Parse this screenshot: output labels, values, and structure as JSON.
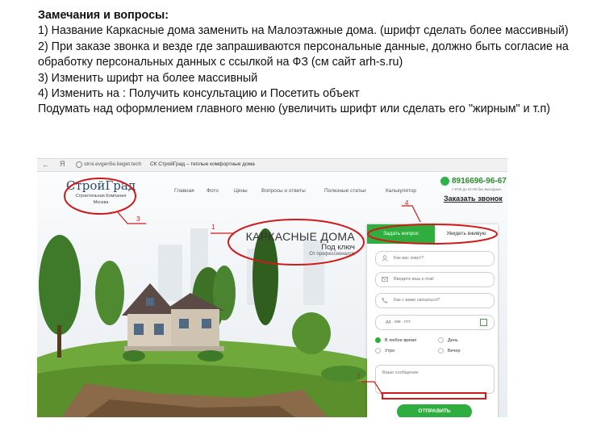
{
  "notes": {
    "title": "Замечания и вопросы:",
    "lines": [
      "1) Название Каркасные дома заменить на Малоэтажные дома. (шрифт сделать более массивный)",
      "2) При заказе звонка и везде где запрашиваются персональные данные, должно быть согласие на обработку персональных данных с ссылкой на ФЗ (см сайт arh-s.ru)",
      "3) Изменить шрифт на более массивный",
      "4) Изменить на : Получить консультацию и Посетить объект",
      "Подумать над оформлением главного меню (увеличить шрифт или сделать его \"жирным\" и т.п)"
    ]
  },
  "browser": {
    "back": "←",
    "yandex": "Я",
    "url": "stroi.evgen5e.beget.tech",
    "tab_title": "СК СтройГрад – теплые комфортные дома"
  },
  "site": {
    "logo_name": "СтройГрад",
    "logo_sub1": "Строительная Компания",
    "logo_sub2": "Москва",
    "nav": [
      "Главная",
      "Фото",
      "Цены",
      "Вопросы и ответы",
      "Полезные статьи",
      "Калькулятор"
    ],
    "phone_prefix": "8916",
    "phone_main": "696-96-67",
    "hours": "с 9:00 до 21:00 без выходных",
    "call_link": "Заказать звонок",
    "headline": "КАРКАСНЫЕ ДОМА",
    "headline_sub": "Под ключ",
    "headline_small": "От профессионалов"
  },
  "form": {
    "tab_active": "Задать вопрос",
    "tab_other": "Увидеть вживую",
    "name_placeholder": "Как вас зовут?",
    "email_placeholder": "Введите ваш e-mail",
    "phone_placeholder": "Как с вами связаться?",
    "date_placeholder": "дд . мм . гггг",
    "time_options": [
      "В любое время",
      "День",
      "Утро",
      "Вечер"
    ],
    "message_placeholder": "Ваше сообщение",
    "submit": "ОТПРАВИТЬ"
  },
  "annotations": [
    "1",
    "2",
    "3",
    "4"
  ],
  "colors": {
    "accent_green": "#2fae3f",
    "annotation_red": "#d01a1a",
    "logo_blue": "#2a4a6b"
  }
}
